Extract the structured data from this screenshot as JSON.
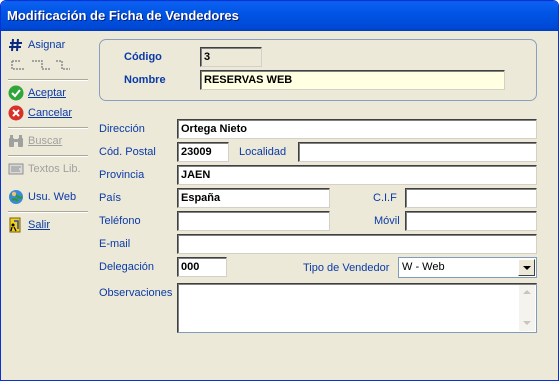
{
  "window": {
    "title": "Modificación de Ficha de Vendedores"
  },
  "toolbar": {
    "asignar": "Asignar",
    "aceptar": "Aceptar",
    "cancelar": "Cancelar",
    "buscar": "Buscar",
    "textos": "Textos Lib.",
    "usu_web": "Usu. Web",
    "salir": "Salir"
  },
  "header": {
    "codigo_label": "Código",
    "codigo_value": "3",
    "nombre_label": "Nombre",
    "nombre_value": "RESERVAS WEB"
  },
  "form": {
    "direccion_label": "Dirección",
    "direccion_value": "Ortega Nieto",
    "cp_label": "Cód. Postal",
    "cp_value": "23009",
    "localidad_label": "Localidad",
    "localidad_value": "",
    "provincia_label": "Provincia",
    "provincia_value": "JAEN",
    "pais_label": "País",
    "pais_value": "España",
    "cif_label": "C.I.F",
    "cif_value": "",
    "telefono_label": "Teléfono",
    "telefono_value": "",
    "movil_label": "Móvil",
    "movil_value": "",
    "email_label": "E-mail",
    "email_value": "",
    "delegacion_label": "Delegación",
    "delegacion_value": "000",
    "tipo_label": "Tipo de Vendedor",
    "tipo_value": "W - Web",
    "observaciones_label": "Observaciones",
    "observaciones_value": ""
  },
  "colors": {
    "title_bar": "#0055e5",
    "label_blue": "#0a3aa8",
    "window_bg": "#ece9d8",
    "highlight_field": "#ffffe1"
  }
}
